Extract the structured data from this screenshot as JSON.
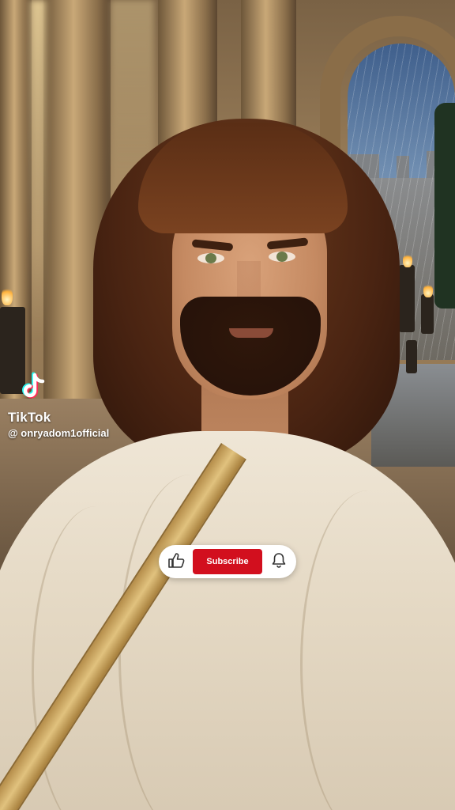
{
  "tiktok": {
    "brand": "TikTok",
    "username": "@ onryadom1official"
  },
  "subscribe_overlay": {
    "subscribe_label": "Subscribe",
    "like_icon": "thumbs-up-icon",
    "bell_icon": "bell-icon",
    "accent_color": "#d20f1e"
  }
}
